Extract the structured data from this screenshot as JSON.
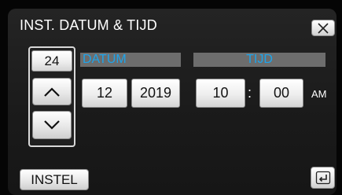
{
  "header": {
    "title": "INST. DATUM & TIJD"
  },
  "date": {
    "label": "DATUM",
    "day": "24",
    "month": "12",
    "year": "2019"
  },
  "time": {
    "label": "TIJD",
    "hour": "10",
    "separator": ":",
    "minute": "00",
    "period": "AM"
  },
  "footer": {
    "set_label": "INSTEL"
  },
  "icons": {
    "close": "close-icon",
    "up": "chevron-up-icon",
    "down": "chevron-down-icon",
    "back": "return-icon"
  },
  "colors": {
    "accent": "#1ea4ea",
    "header_bar": "#6d6d6d",
    "background": "#1c1c1c"
  }
}
